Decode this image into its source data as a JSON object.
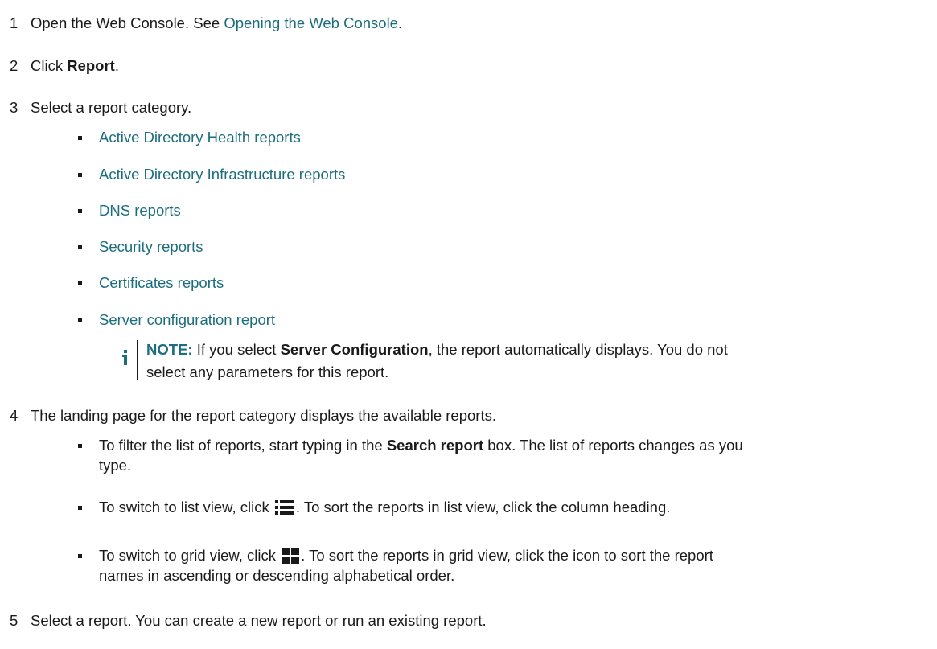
{
  "steps": [
    {
      "num": "1",
      "text_before": "Open the Web Console. See ",
      "link": "Opening the Web Console",
      "text_after": "."
    },
    {
      "num": "2",
      "text_before": "Click ",
      "bold": "Report",
      "text_after": "."
    },
    {
      "num": "3",
      "text": "Select a report category."
    },
    {
      "num": "4",
      "text": "The landing page for the report category displays the available reports."
    },
    {
      "num": "5",
      "text": "Select a report. You can create a new report or run an existing report."
    }
  ],
  "categories": [
    "Active Directory Health reports",
    "Active Directory Infrastructure reports",
    "DNS reports",
    "Security reports",
    "Certificates reports",
    "Server configuration report"
  ],
  "note": {
    "label": "NOTE:",
    "text1": " If you select ",
    "bold": "Server Configuration",
    "text2": ", the report automatically displays. You do not",
    "line2": "select any parameters for this report.",
    "icon": "info-icon"
  },
  "tips": {
    "filter": {
      "before": "To filter the list of reports, start typing in the ",
      "bold": "Search report",
      "after": " box. The list of reports changes as you",
      "line2": "type."
    },
    "list_view": {
      "before": "To switch to list view, click ",
      "after": ". To sort the reports in list view, click the column heading.",
      "icon": "list-view-icon"
    },
    "grid_view": {
      "before": "To switch to grid view, click ",
      "after": ". To sort the reports in grid view, click the icon to sort the report",
      "line2": "names in ascending or descending alphabetical order.",
      "icon": "grid-view-icon"
    }
  },
  "colors": {
    "link": "#1c6e7e",
    "text": "#1a1a1a"
  }
}
